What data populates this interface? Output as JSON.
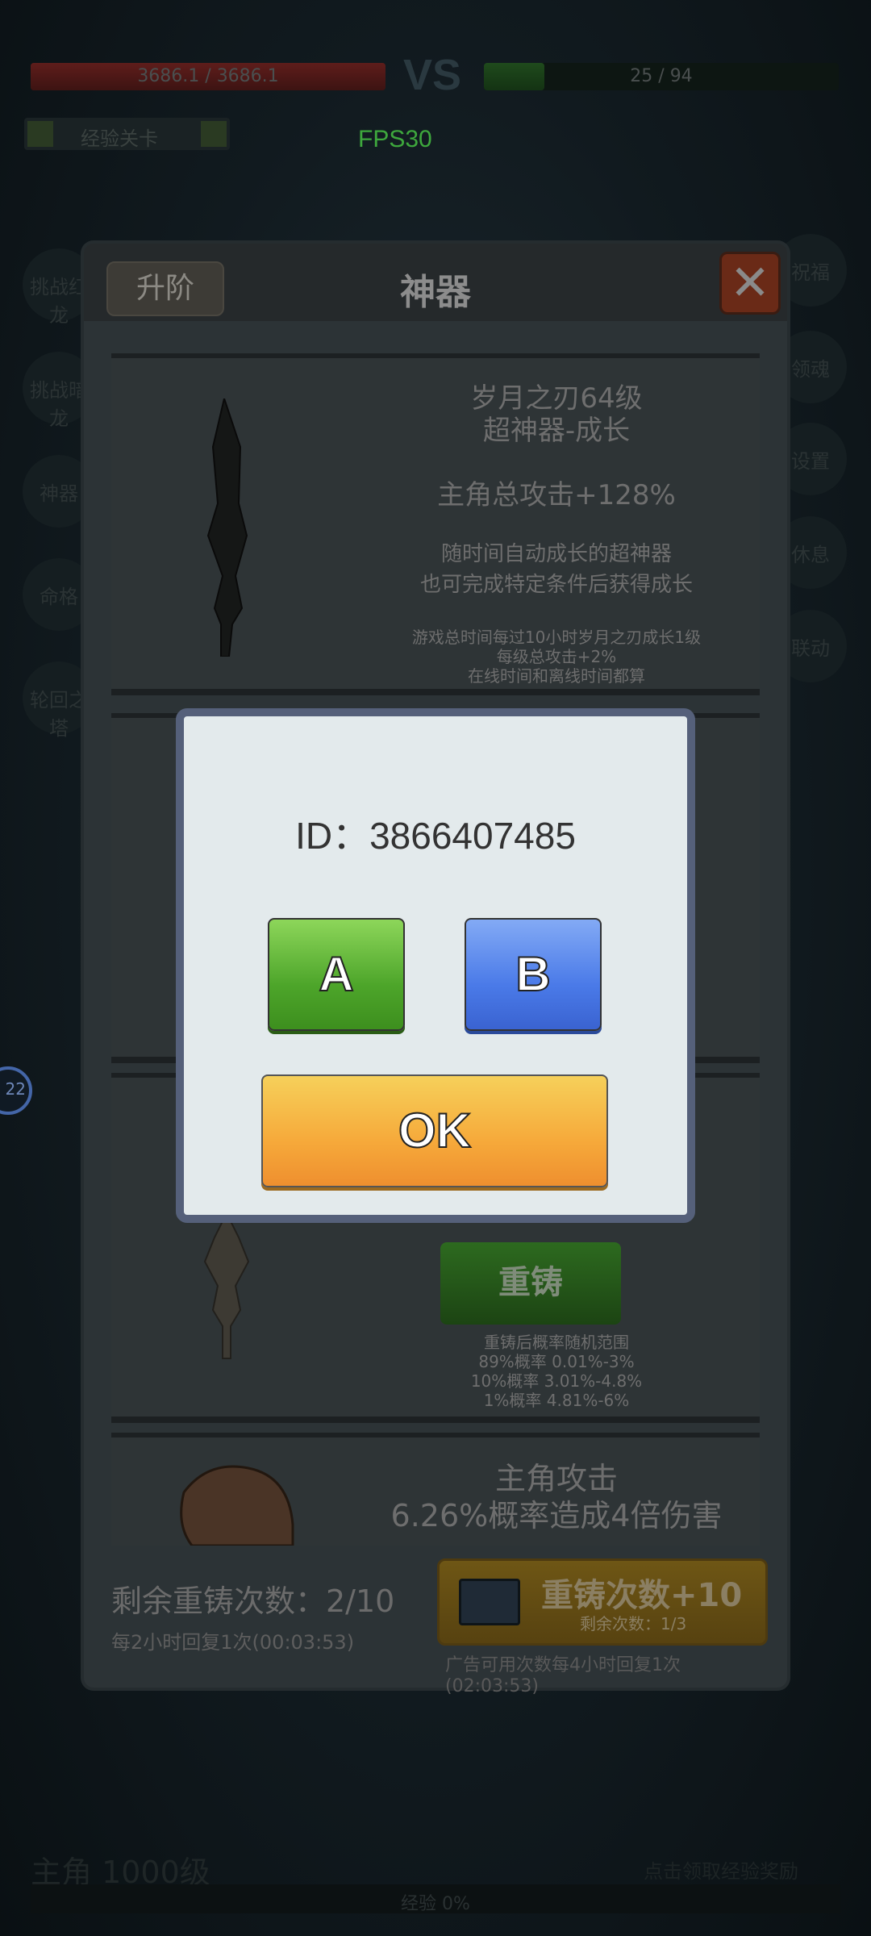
{
  "hud": {
    "left_bar_text": "3686.1 / 3686.1",
    "vs": "VS",
    "right_bar_text": "25 / 94",
    "stage_label": "经验关卡",
    "fps": "FPS30",
    "side_left": [
      "挑战红龙",
      "挑战暗龙",
      "神器",
      "命格",
      "轮回之塔"
    ],
    "side_right": [
      "祝福",
      "领魂",
      "设置",
      "休息",
      "联动"
    ],
    "left_badge": "22",
    "player_level": "主角 1000级",
    "receive_text": "点击领取经验奖励",
    "exp_text": "经验 0%"
  },
  "panel": {
    "title": "神器",
    "upgrade_label": "升阶",
    "close_label": "✕",
    "card1": {
      "name": "岁月之刃64级",
      "tier": "超神器-成长",
      "effect": "主角总攻击+128%",
      "desc1": "随时间自动成长的超神器",
      "desc2": "也可完成特定条件后获得成长",
      "note1": "游戏总时间每过10小时岁月之刃成长1级",
      "note2": "每级总攻击+2%",
      "note3": "在线时间和离线时间都算"
    },
    "card3": {
      "reforge_label": "重铸",
      "range_title": "重铸后概率随机范围",
      "range1": "89%概率 0.01%-3%",
      "range2": "10%概率 3.01%-4.8%",
      "range3": "1%概率 4.81%-6%"
    },
    "card4": {
      "line1": "主角攻击",
      "line2": "6.26%概率造成4倍伤害"
    },
    "footer": {
      "remain_label": "剩余重铸次数：2/10",
      "recover_label": "每2小时回复1次(00:03:53)",
      "ad_title": "重铸次数+10",
      "ad_sub": "剩余次数：1/3",
      "ad_note": "广告可用次数每4小时回复1次(02:03:53)"
    }
  },
  "dialog": {
    "id_label": "ID：3866407485",
    "button_a": "A",
    "button_b": "B",
    "ok_label": "OK"
  },
  "colors": {
    "button_a": "#4da52a",
    "button_b": "#4a7ae8",
    "ok": "#f6a93a",
    "dialog_bg": "#e3eaec",
    "dialog_border": "#55607a"
  }
}
